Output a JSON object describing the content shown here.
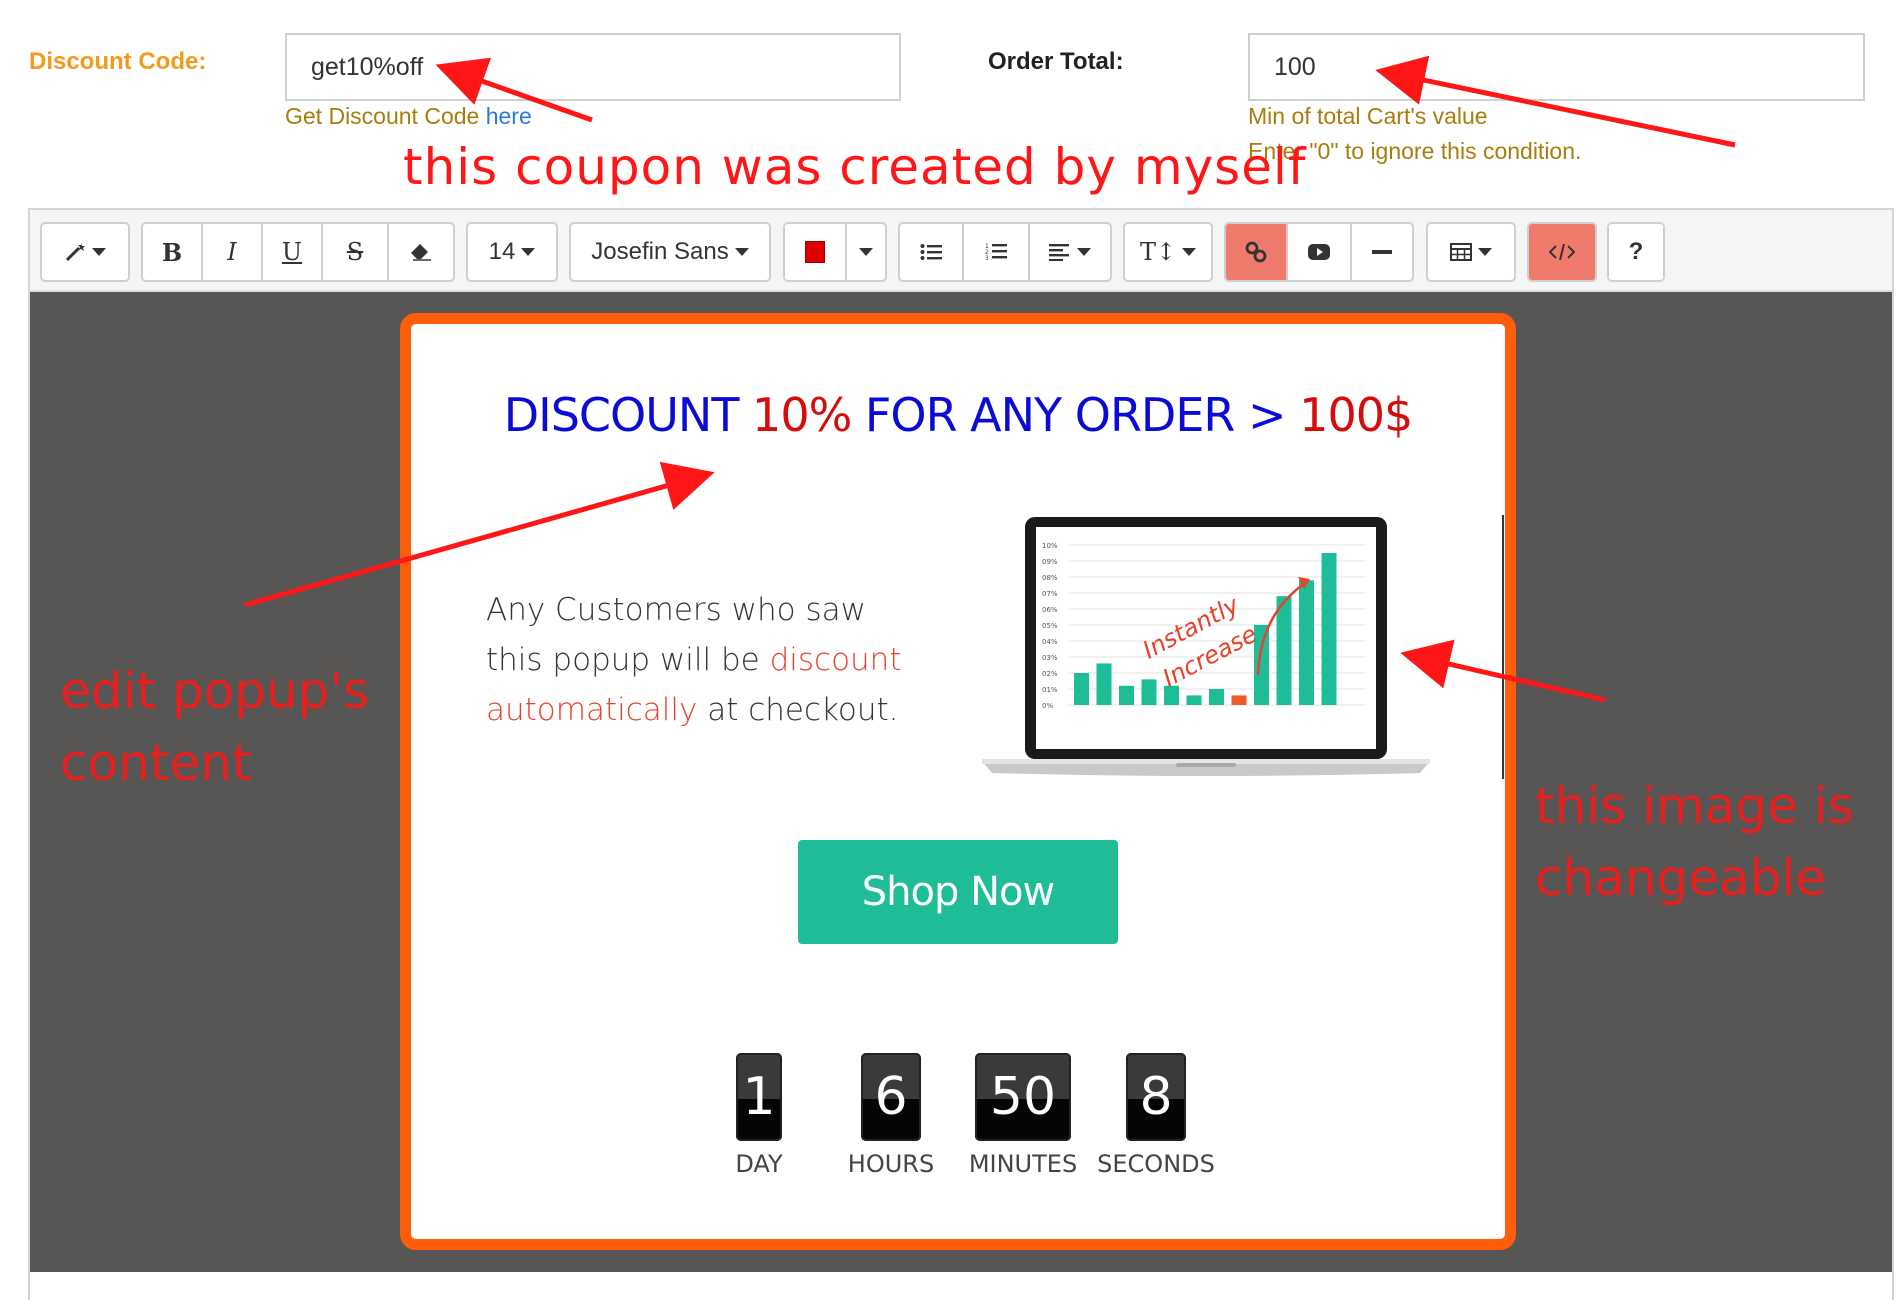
{
  "form": {
    "discount_label": "Discount Code:",
    "discount_value": "get10%off",
    "discount_help_prefix": "Get Discount Code ",
    "discount_help_link": "here",
    "order_label": "Order Total:",
    "order_value": "100",
    "order_help_1": "Min of total Cart's value",
    "order_help_2": "Enter \"0\" to ignore this condition."
  },
  "annotations": {
    "top": "this coupon was created by myself",
    "left_1": "edit popup's",
    "left_2": "content",
    "right_1": "this image is",
    "right_2": "changeable"
  },
  "toolbar": {
    "style_icon": "magic-wand-icon",
    "bold": "B",
    "italic": "I",
    "underline": "U",
    "strike": "S",
    "eraser_icon": "eraser-icon",
    "font_size": "14",
    "font_name": "Josefin Sans",
    "text_color": "#e00000",
    "ul_icon": "unordered-list-icon",
    "ol_icon": "ordered-list-icon",
    "align_icon": "align-left-icon",
    "line_height": "T↕",
    "link_icon": "link-icon",
    "video_icon": "video-icon",
    "hr_icon": "horizontal-rule-icon",
    "table_icon": "table-icon",
    "code_icon": "code-view-icon",
    "help": "?"
  },
  "popup": {
    "headline_a": "DISCOUNT ",
    "headline_b": "10%",
    "headline_c": " FOR ANY ORDER > ",
    "headline_d": "100$",
    "body_1": "Any Customers who saw this popup will be ",
    "body_hl_1": "discount",
    "body_hl_2": "automatically",
    "body_2": " at checkout.",
    "image_text_1": "Instantly",
    "image_text_2": "Increase",
    "image_yticks": [
      "10%",
      "09%",
      "08%",
      "07%",
      "06%",
      "05%",
      "04%",
      "03%",
      "02%",
      "01%",
      "0%"
    ],
    "shop_button": "Shop Now",
    "countdown": [
      {
        "value": "1",
        "label": "DAY"
      },
      {
        "value": "6",
        "label": "HOURS"
      },
      {
        "value": "50",
        "label": "MINUTES"
      },
      {
        "value": "8",
        "label": "SECONDS"
      }
    ]
  },
  "colors": {
    "border": "#ff5d0a",
    "headline_blue": "#0b0bd6",
    "headline_red": "#d60b0b",
    "button": "#1ebd98",
    "annotation": "#ff1616"
  }
}
